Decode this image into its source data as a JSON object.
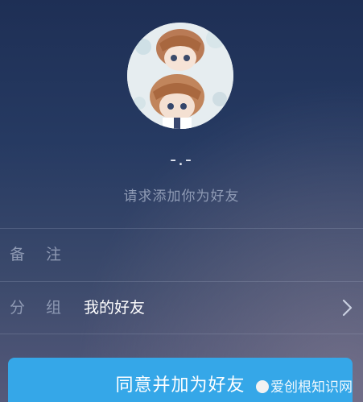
{
  "profile": {
    "nickname": "-.-",
    "request_text": "请求添加你为好友"
  },
  "fields": {
    "remark_label": "备注",
    "remark_value": "",
    "group_label": "分组",
    "group_value": "我的好友"
  },
  "actions": {
    "accept_label": "同意并加为好友"
  },
  "watermark": {
    "text": "爱创根知识网"
  },
  "colors": {
    "accent": "#35a7e8",
    "background_top": "#1e2f55",
    "background_bottom": "#55597a"
  },
  "icons": {
    "group_row_arrow": "chevron-right-icon",
    "avatar": "anime-avatar-image"
  }
}
